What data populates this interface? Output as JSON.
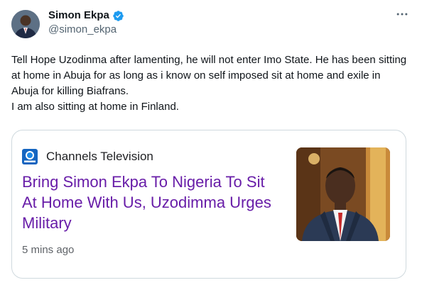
{
  "author": {
    "display_name": "Simon Ekpa",
    "handle": "@simon_ekpa",
    "verified": true
  },
  "tweet": {
    "text": "Tell Hope Uzodinma after lamenting, he will not enter Imo State. He has been sitting at home in Abuja for as long as i know on self imposed sit at home and exile in Abuja for killing Biafrans.\nI am also sitting at home in Finland."
  },
  "card": {
    "source": "Channels Television",
    "headline": "Bring Simon Ekpa To Nigeria To Sit At Home With Us, Uzodimma Urges Military",
    "time": "5 mins ago"
  },
  "icons": {
    "more": "more-horizontal-icon",
    "verified": "verified-badge-icon",
    "source_logo": "channels-logo-icon"
  },
  "colors": {
    "headline": "#681da8",
    "verified": "#1d9bf0",
    "secondary_text": "#536471"
  }
}
